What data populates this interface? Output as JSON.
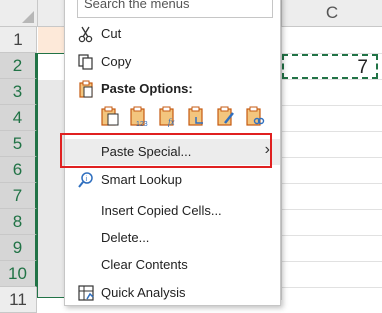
{
  "columns": {
    "c_label": "C"
  },
  "rows": [
    "1",
    "2",
    "3",
    "4",
    "5",
    "6",
    "7",
    "8",
    "9",
    "10",
    "11"
  ],
  "copied_cell_value": "7",
  "menu": {
    "search_placeholder": "Search the menus",
    "cut": "Cut",
    "copy": "Copy",
    "paste_options_title": "Paste Options:",
    "paste_special": "Paste Special...",
    "smart_lookup": "Smart Lookup",
    "insert_copied_cells": "Insert Copied Cells...",
    "delete": "Delete...",
    "clear_contents": "Clear Contents",
    "quick_analysis": "Quick Analysis"
  },
  "colors": {
    "accent_green": "#217346",
    "highlight_red": "#e02020",
    "copy_icon_orange": "#c55a11",
    "paste_icon_blue": "#2f6fbf"
  }
}
